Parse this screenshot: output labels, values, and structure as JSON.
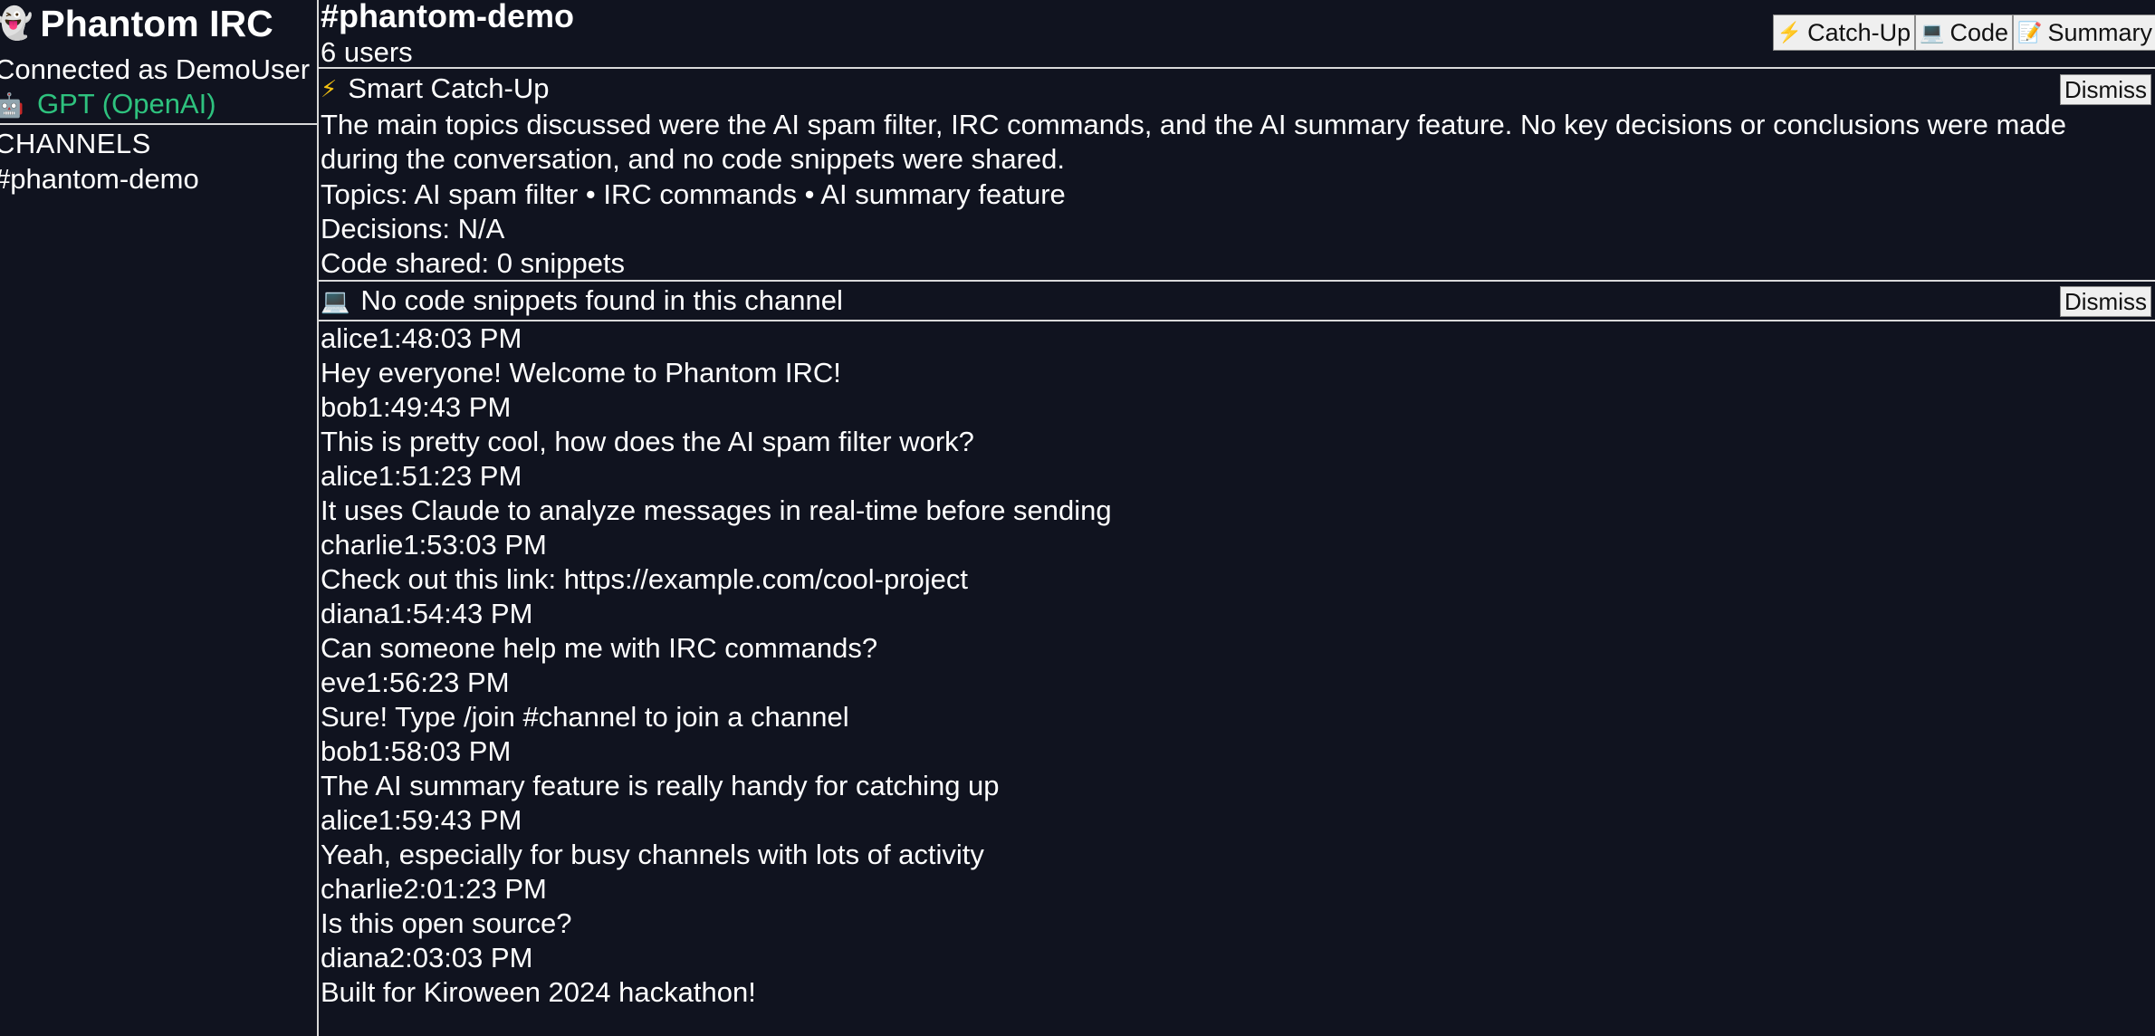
{
  "app": {
    "name": "Phantom IRC",
    "connected_as": "Connected as DemoUser",
    "model": "GPT (OpenAI)"
  },
  "sidebar": {
    "title": "CHANNELS",
    "channels": [
      "#phantom-demo"
    ]
  },
  "channel": {
    "name": "#phantom-demo",
    "users": "6 users"
  },
  "toolbar": {
    "catchup": "Catch-Up",
    "code": "Code",
    "summary": "Summary"
  },
  "catchup": {
    "title": "Smart Catch-Up",
    "dismiss": "Dismiss",
    "summary": "The main topics discussed were the AI spam filter, IRC commands, and the AI summary feature. No key decisions or conclusions were made during the conversation, and no code snippets were shared.",
    "topics": "Topics: AI spam filter • IRC commands • AI summary feature",
    "decisions": "Decisions: N/A",
    "code_shared": "Code shared: 0 snippets"
  },
  "code_panel": {
    "title": "No code snippets found in this channel",
    "dismiss": "Dismiss"
  },
  "messages": [
    {
      "user": "alice",
      "time": "1:48:03 PM",
      "text": "Hey everyone! Welcome to Phantom IRC!"
    },
    {
      "user": "bob",
      "time": "1:49:43 PM",
      "text": "This is pretty cool, how does the AI spam filter work?"
    },
    {
      "user": "alice",
      "time": "1:51:23 PM",
      "text": "It uses Claude to analyze messages in real-time before sending"
    },
    {
      "user": "charlie",
      "time": "1:53:03 PM",
      "text": "Check out this link: https://example.com/cool-project"
    },
    {
      "user": "diana",
      "time": "1:54:43 PM",
      "text": "Can someone help me with IRC commands?"
    },
    {
      "user": "eve",
      "time": "1:56:23 PM",
      "text": "Sure! Type /join #channel to join a channel"
    },
    {
      "user": "bob",
      "time": "1:58:03 PM",
      "text": "The AI summary feature is really handy for catching up"
    },
    {
      "user": "alice",
      "time": "1:59:43 PM",
      "text": "Yeah, especially for busy channels with lots of activity"
    },
    {
      "user": "charlie",
      "time": "2:01:23 PM",
      "text": "Is this open source?"
    },
    {
      "user": "diana",
      "time": "2:03:03 PM",
      "text": "Built for Kiroween 2024 hackathon!"
    }
  ],
  "icons": {
    "ghost": "ghost-icon",
    "robot": "robot-icon",
    "lightning": "lightning-icon",
    "laptop": "laptop-icon",
    "memo": "memo-icon"
  },
  "colors": {
    "background": "#10131f",
    "text": "#ffffff",
    "model_accent": "#2ec27e",
    "divider": "#d9d9d9",
    "button_bg": "#efefef"
  }
}
